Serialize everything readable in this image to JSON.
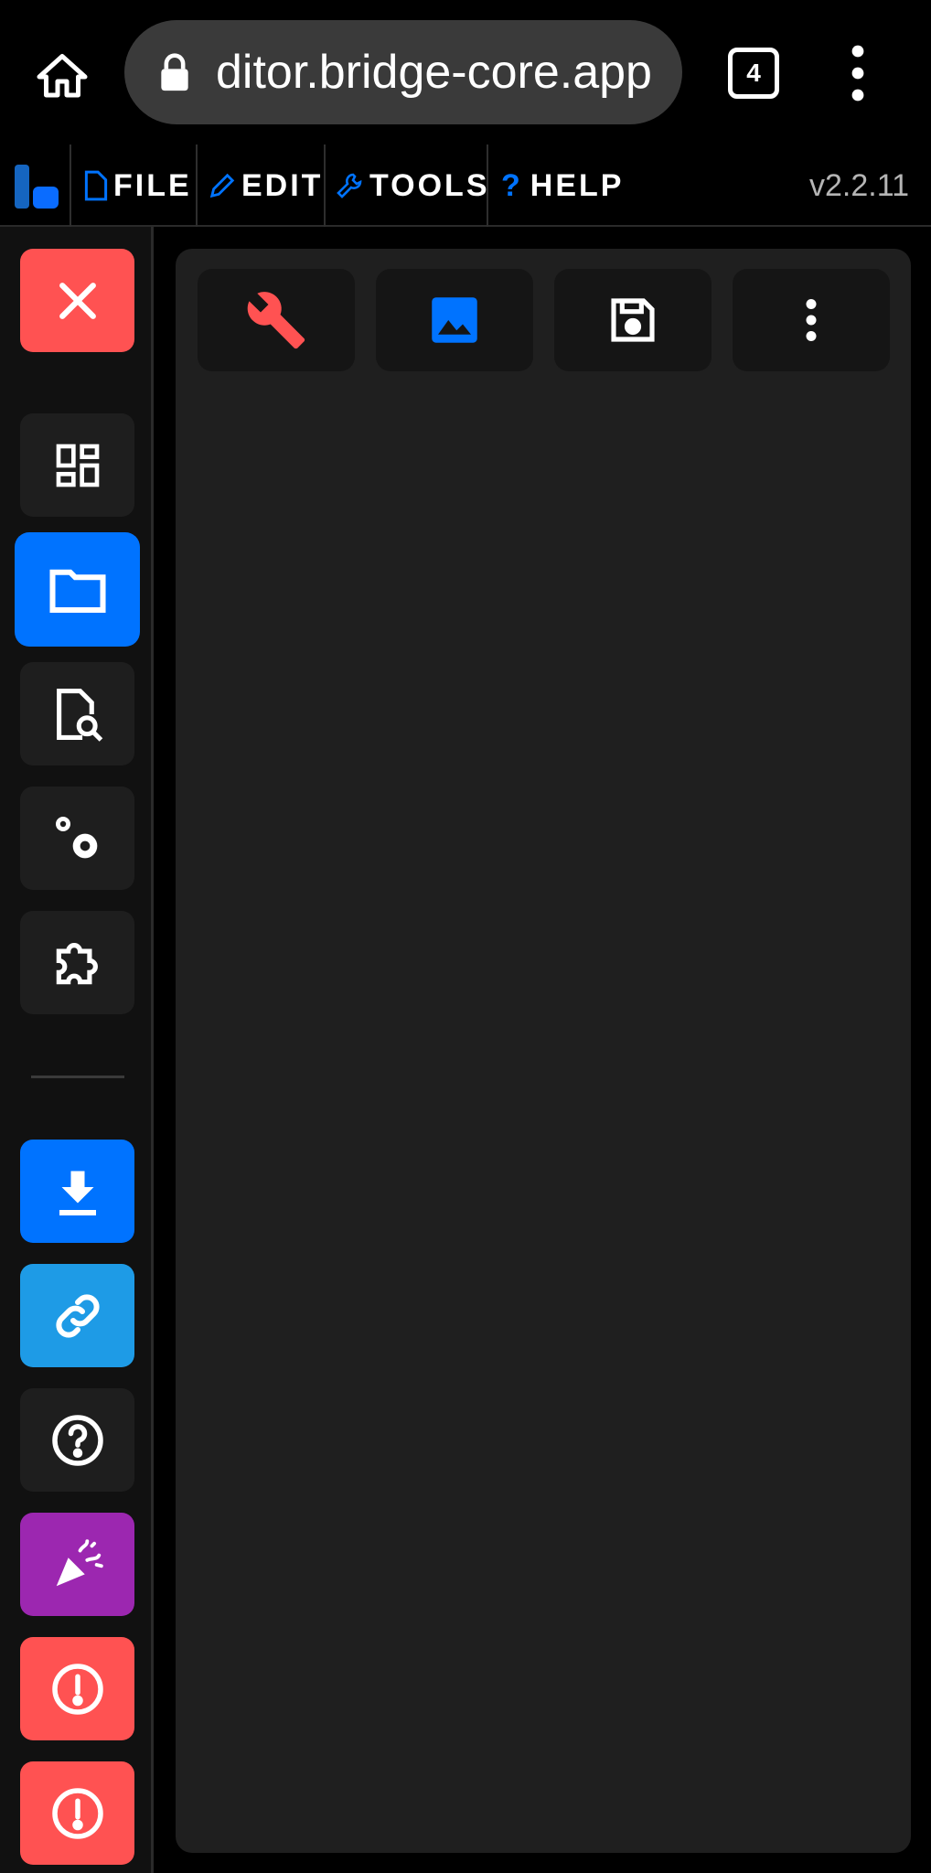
{
  "browser": {
    "url": "ditor.bridge-core.app",
    "tab_count": "4"
  },
  "menubar": {
    "items": [
      {
        "label": "FILE",
        "icon": "file-icon"
      },
      {
        "label": "EDIT",
        "icon": "pencil-icon"
      },
      {
        "label": "TOOLS",
        "icon": "wrench-icon"
      },
      {
        "label": "HELP",
        "icon": "question-icon"
      }
    ],
    "version": "v2.2.11"
  },
  "sidebar": {
    "buttons": [
      {
        "name": "close",
        "icon": "close-icon",
        "color": "#ff5252"
      },
      {
        "name": "dashboard",
        "icon": "dashboard-icon",
        "color": "#1e1e1e"
      },
      {
        "name": "explorer",
        "icon": "folder-icon",
        "color": "#0073ff",
        "active": true
      },
      {
        "name": "file-search",
        "icon": "file-search-icon",
        "color": "#1e1e1e"
      },
      {
        "name": "settings",
        "icon": "gears-icon",
        "color": "#1e1e1e"
      },
      {
        "name": "extensions",
        "icon": "puzzle-icon",
        "color": "#1e1e1e"
      },
      {
        "name": "download",
        "icon": "download-icon",
        "color": "#0073ff"
      },
      {
        "name": "link",
        "icon": "link-icon",
        "color": "#1e9be6"
      },
      {
        "name": "help",
        "icon": "help-circle-icon",
        "color": "#1e1e1e"
      },
      {
        "name": "whats-new",
        "icon": "party-popper-icon",
        "color": "#9c27b0"
      },
      {
        "name": "error-1",
        "icon": "alert-icon",
        "color": "#ff5252"
      },
      {
        "name": "error-2",
        "icon": "alert-icon",
        "color": "#ff5252"
      }
    ]
  },
  "toolbar": {
    "buttons": [
      {
        "name": "tools",
        "icon": "wrench-icon",
        "color": "#ff5252"
      },
      {
        "name": "image",
        "icon": "image-icon",
        "color": "#0073ff"
      },
      {
        "name": "save",
        "icon": "save-icon",
        "color": "#ffffff"
      },
      {
        "name": "more",
        "icon": "more-vertical-icon",
        "color": "#ffffff"
      }
    ]
  }
}
